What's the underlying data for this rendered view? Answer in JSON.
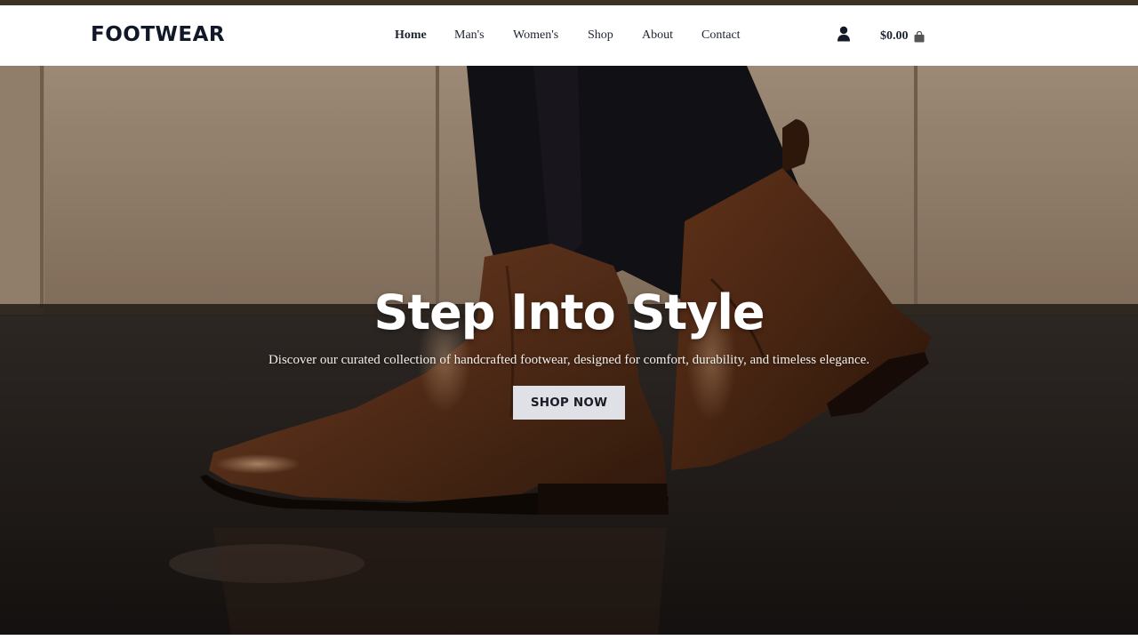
{
  "brand": {
    "logo": "FOOTWEAR"
  },
  "nav": {
    "items": [
      {
        "label": "Home",
        "active": true
      },
      {
        "label": "Man's",
        "active": false
      },
      {
        "label": "Women's",
        "active": false
      },
      {
        "label": "Shop",
        "active": false
      },
      {
        "label": "About",
        "active": false
      },
      {
        "label": "Contact",
        "active": false
      }
    ]
  },
  "header_actions": {
    "account_icon": "user-icon",
    "cart_total": "$0.00",
    "cart_icon": "shopping-bag-icon"
  },
  "hero": {
    "title": "Step Into Style",
    "subtitle": "Discover our curated collection of handcrafted footwear, designed for comfort, durability, and timeless elegance.",
    "cta_label": "SHOP NOW"
  },
  "colors": {
    "top_bar": "#3d3322",
    "text_dark": "#1f2430",
    "cta_background": "#dfe1e7",
    "boot_leather": "#6b3a1f"
  }
}
